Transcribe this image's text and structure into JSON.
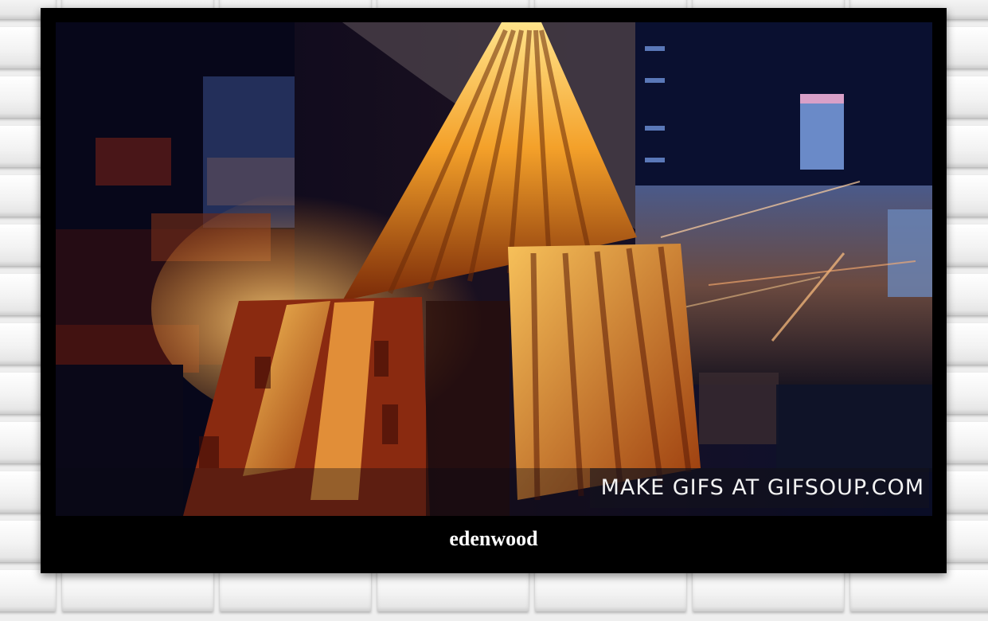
{
  "gif": {
    "watermark": "MAKE GIFS AT GIFSOUP.COM"
  },
  "caption": "edenwood"
}
